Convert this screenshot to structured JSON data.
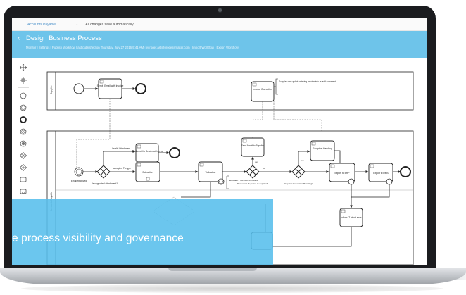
{
  "app": {
    "account_selector": "Accounts Payable",
    "account_chevron": "⌄",
    "autosave_status": "All changes save automatically"
  },
  "header": {
    "back_icon": "‹",
    "title": "Design Business Process",
    "subline": "Monitor | Settings | Publish Workflow (last published on Thursday, July 27 2016 9:41 AM) by roger.ast@processmaker.com | Import Workflow | Export Workflow"
  },
  "palette": {
    "items": [
      "move-tool-icon",
      "connect-tool-icon",
      "start-event-icon",
      "intermediate-event-icon",
      "end-event-icon",
      "timer-event-icon",
      "message-event-icon",
      "exclusive-gateway-icon",
      "parallel-gateway-icon",
      "task-icon",
      "subprocess-icon"
    ]
  },
  "diagram": {
    "lanes": [
      "Supplier",
      "Accounts Payable"
    ],
    "supplier_tasks": {
      "send_email": "Sends Email with Invoice",
      "invoice_correction": "Invoice Correction"
    },
    "annotations": {
      "supplier_note": "Supplier can update missing invoice info or add comment",
      "escalate_note": "Escalate if not fixed in 3 days"
    },
    "ap_tasks": {
      "extraction": "Extraction",
      "send_email_sender": "Send email to Sender with error",
      "validation": "Validation",
      "send_email_supplier": "Send Email to Supplier",
      "exception_handling": "Exception Handling",
      "export_erp": "Export to ERP",
      "export_dms": "Export to DMS",
      "inform_error": "Inform IT about error"
    },
    "events": {
      "email_received": "Email Received"
    },
    "flow_labels": {
      "invalid_attachment": "Invalid Attachment",
      "accepted_filetype": "accepted Filetype",
      "is_supported": "Is supported attachment?",
      "document_rejected": "Document Rejected to supplier?",
      "requires_exception": "Requires Exception Handling?",
      "yes": "yes",
      "no": "no"
    }
  },
  "promo": {
    "text": "e process visibility and governance"
  },
  "colors": {
    "header_bg": "#6ec4ea",
    "promo_bg": "#56beec",
    "laptop_bezel": "#1b1c1f"
  }
}
